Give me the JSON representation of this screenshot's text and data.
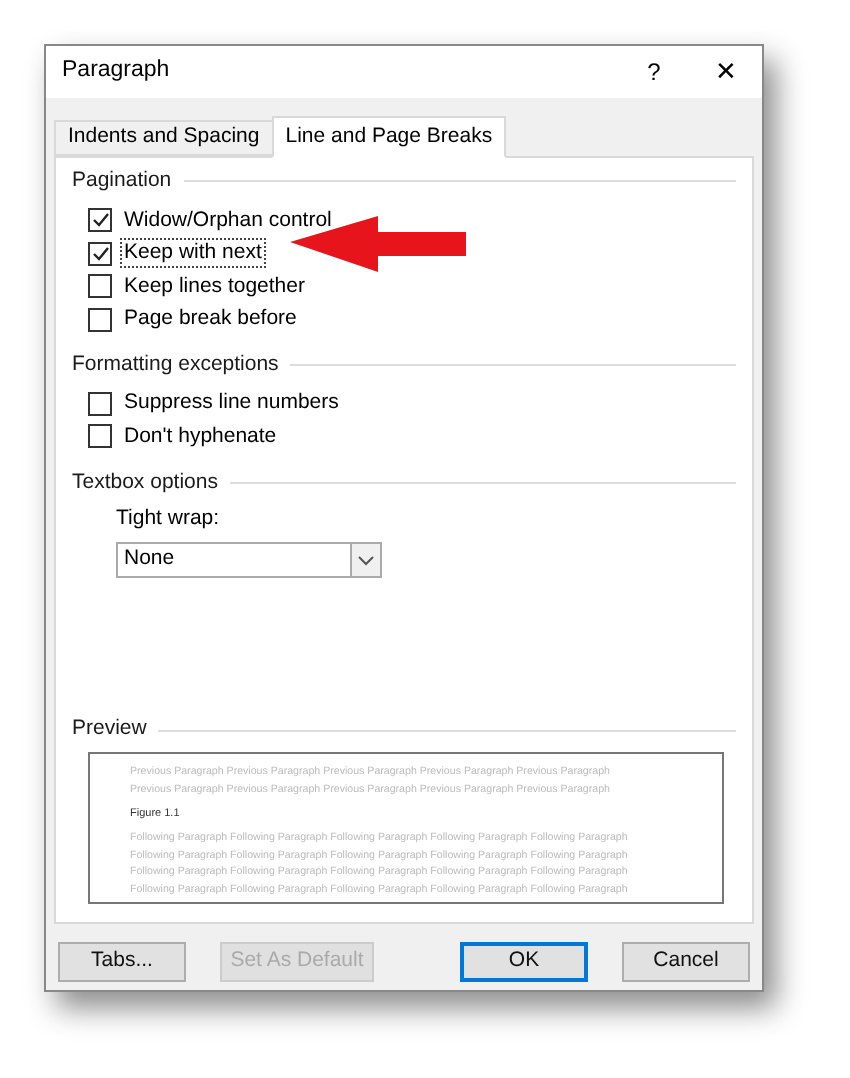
{
  "window": {
    "title": "Paragraph",
    "help": "?",
    "close": "✕"
  },
  "tabs": [
    {
      "label": "Indents and Spacing",
      "selected": false
    },
    {
      "label": "Line and Page Breaks",
      "selected": true
    }
  ],
  "sections": [
    {
      "title": "Pagination",
      "items": [
        {
          "kind": "checkbox",
          "label": "Widow/Orphan control",
          "checked": true
        },
        {
          "kind": "checkbox",
          "label": "Keep with next",
          "checked": true,
          "focused": true
        },
        {
          "kind": "checkbox",
          "label": "Keep lines together",
          "checked": false
        },
        {
          "kind": "checkbox",
          "label": "Page break before",
          "checked": false
        }
      ]
    },
    {
      "title": "Formatting exceptions",
      "items": [
        {
          "kind": "checkbox",
          "label": "Suppress line numbers",
          "checked": false
        },
        {
          "kind": "checkbox",
          "label": "Don't hyphenate",
          "checked": false
        }
      ]
    },
    {
      "title": "Textbox options",
      "items": [
        {
          "kind": "dropdown",
          "label": "Tight wrap:",
          "value": "None"
        }
      ]
    }
  ],
  "preview": {
    "title": "Preview",
    "previous_lines": [
      "Previous Paragraph Previous Paragraph Previous Paragraph Previous Paragraph Previous Paragraph",
      "Previous Paragraph Previous Paragraph Previous Paragraph Previous Paragraph Previous Paragraph"
    ],
    "sample": "Figure 1.1",
    "following_lines": [
      "Following Paragraph Following Paragraph Following Paragraph Following Paragraph Following Paragraph",
      "Following Paragraph Following Paragraph Following Paragraph Following Paragraph Following Paragraph",
      "Following Paragraph Following Paragraph Following Paragraph Following Paragraph Following Paragraph",
      "Following Paragraph Following Paragraph Following Paragraph Following Paragraph Following Paragraph"
    ]
  },
  "buttons": [
    {
      "label": "Tabs...",
      "disabled": false,
      "default": false
    },
    {
      "label": "Set As Default",
      "disabled": true,
      "default": false
    },
    {
      "label": "OK",
      "disabled": false,
      "default": true
    },
    {
      "label": "Cancel",
      "disabled": false,
      "default": false
    }
  ]
}
